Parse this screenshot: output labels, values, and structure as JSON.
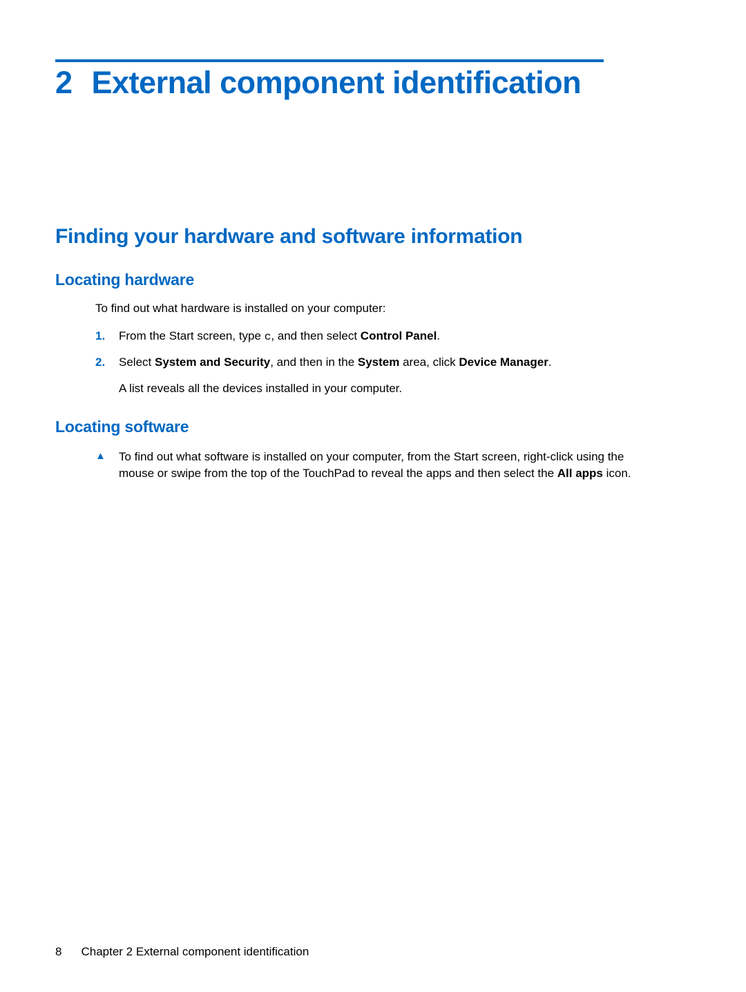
{
  "chapter": {
    "number": "2",
    "title": "External component identification"
  },
  "section": {
    "title": "Finding your hardware and software information"
  },
  "subsections": {
    "hardware": {
      "title": "Locating hardware",
      "intro": "To find out what hardware is installed on your computer:",
      "steps": [
        {
          "marker": "1.",
          "parts": [
            {
              "text": "From the Start screen, type ",
              "bold": false
            },
            {
              "text": "c",
              "mono": true
            },
            {
              "text": ", and then select ",
              "bold": false
            },
            {
              "text": "Control Panel",
              "bold": true
            },
            {
              "text": ".",
              "bold": false
            }
          ]
        },
        {
          "marker": "2.",
          "parts": [
            {
              "text": "Select ",
              "bold": false
            },
            {
              "text": "System and Security",
              "bold": true
            },
            {
              "text": ", and then in the ",
              "bold": false
            },
            {
              "text": "System",
              "bold": true
            },
            {
              "text": " area, click ",
              "bold": false
            },
            {
              "text": "Device Manager",
              "bold": true
            },
            {
              "text": ".",
              "bold": false
            }
          ],
          "subtext": "A list reveals all the devices installed in your computer."
        }
      ]
    },
    "software": {
      "title": "Locating software",
      "bullet": {
        "marker": "▲",
        "parts": [
          {
            "text": "To find out what software is installed on your computer, from the Start screen, right-click using the mouse or swipe from the top of the TouchPad to reveal the apps and then select the ",
            "bold": false
          },
          {
            "text": "All apps",
            "bold": true
          },
          {
            "text": " icon.",
            "bold": false
          }
        ]
      }
    }
  },
  "footer": {
    "page": "8",
    "chapter_label": "Chapter 2   External component identification"
  }
}
